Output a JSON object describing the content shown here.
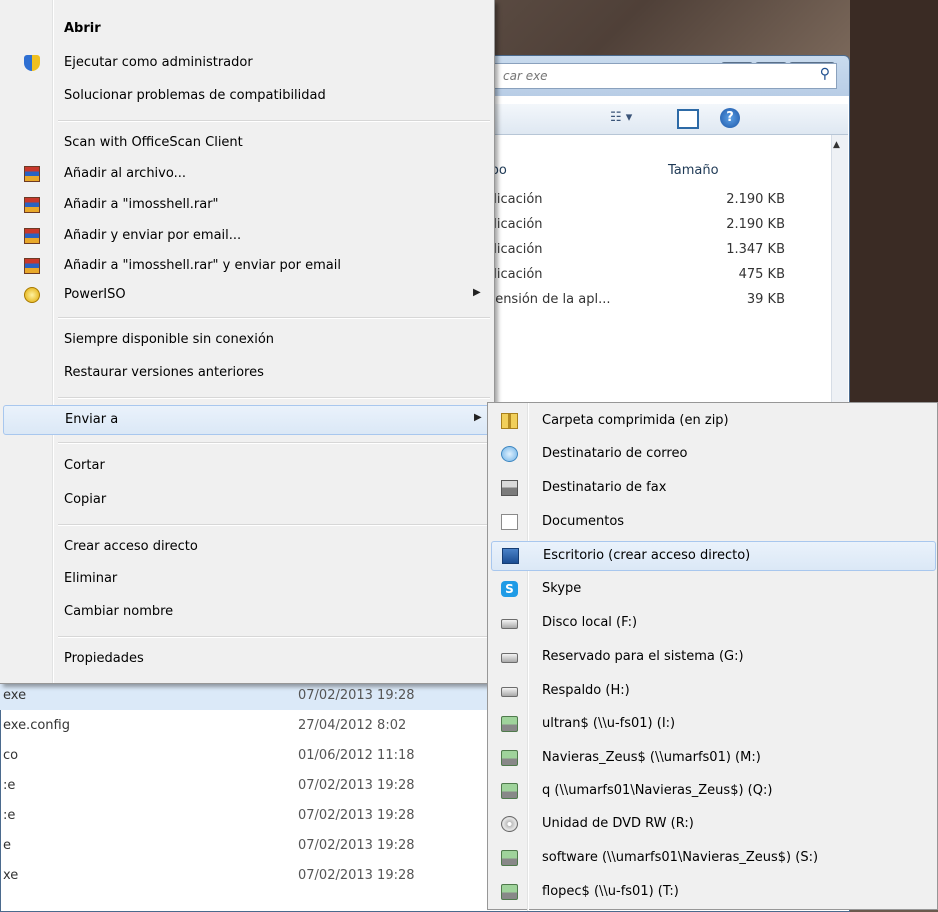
{
  "explorer": {
    "search_placeholder": "car exe",
    "column_type": "ipo",
    "column_size": "Tamaño",
    "view_icon": "view-options-icon",
    "right_rows": [
      {
        "type": "plicación",
        "size": "2.190 KB"
      },
      {
        "type": "plicación",
        "size": "2.190 KB"
      },
      {
        "type": "plicación",
        "size": "1.347 KB"
      },
      {
        "type": "plicación",
        "size": "475 KB"
      },
      {
        "type": "ttensión de la apl...",
        "size": "39 KB"
      }
    ],
    "bottom_rows": [
      {
        "name": "exe",
        "date": "07/02/2013 19:28"
      },
      {
        "name": "exe.config",
        "date": "27/04/2012 8:02"
      },
      {
        "name": "co",
        "date": "01/06/2012 11:18"
      },
      {
        "name": ":e",
        "date": "07/02/2013 19:28"
      },
      {
        "name": ":e",
        "date": "07/02/2013 19:28"
      },
      {
        "name": "e",
        "date": "07/02/2013 19:28"
      },
      {
        "name": "xe",
        "date": "07/02/2013 19:28"
      }
    ]
  },
  "context_menu": {
    "items": [
      {
        "label": "Abrir"
      },
      {
        "label": "Ejecutar como administrador",
        "icon": "shield-icon"
      },
      {
        "label": "Solucionar problemas de compatibilidad"
      },
      {
        "label": "Scan with OfficeScan Client"
      },
      {
        "label": "Añadir al archivo...",
        "icon": "winrar-icon"
      },
      {
        "label": "Añadir a \"imosshell.rar\"",
        "icon": "winrar-icon"
      },
      {
        "label": "Añadir y enviar por email...",
        "icon": "winrar-icon"
      },
      {
        "label": "Añadir a \"imosshell.rar\" y enviar por email",
        "icon": "winrar-icon"
      },
      {
        "label": "PowerISO",
        "icon": "poweriso-icon"
      },
      {
        "label": "Siempre disponible sin conexión"
      },
      {
        "label": "Restaurar versiones anteriores"
      },
      {
        "label": "Enviar a"
      },
      {
        "label": "Cortar"
      },
      {
        "label": "Copiar"
      },
      {
        "label": "Crear acceso directo"
      },
      {
        "label": "Eliminar"
      },
      {
        "label": "Cambiar nombre"
      },
      {
        "label": "Propiedades"
      }
    ]
  },
  "send_to_menu": {
    "items": [
      {
        "label": "Carpeta comprimida (en zip)",
        "icon": "zip-folder-icon"
      },
      {
        "label": "Destinatario de correo",
        "icon": "mail-recipient-icon"
      },
      {
        "label": "Destinatario de fax",
        "icon": "fax-icon"
      },
      {
        "label": "Documentos",
        "icon": "documents-icon"
      },
      {
        "label": "Escritorio (crear acceso directo)",
        "icon": "desktop-icon"
      },
      {
        "label": "Skype",
        "icon": "skype-icon"
      },
      {
        "label": "Disco local (F:)",
        "icon": "drive-icon"
      },
      {
        "label": "Reservado para el sistema (G:)",
        "icon": "drive-icon"
      },
      {
        "label": "Respaldo (H:)",
        "icon": "drive-icon"
      },
      {
        "label": "ultran$ (\\\\u-fs01) (I:)",
        "icon": "network-drive-icon"
      },
      {
        "label": "Navieras_Zeus$ (\\\\umarfs01) (M:)",
        "icon": "network-drive-icon"
      },
      {
        "label": "q (\\\\umarfs01\\Navieras_Zeus$) (Q:)",
        "icon": "network-drive-icon"
      },
      {
        "label": "Unidad de DVD RW (R:)",
        "icon": "dvd-drive-icon"
      },
      {
        "label": "software (\\\\umarfs01\\Navieras_Zeus$) (S:)",
        "icon": "network-drive-icon"
      },
      {
        "label": "flopec$ (\\\\u-fs01) (T:)",
        "icon": "network-drive-icon"
      }
    ]
  },
  "colors": {
    "highlight_border": "#a8c7ee",
    "menu_bg": "#f0f0f0"
  }
}
